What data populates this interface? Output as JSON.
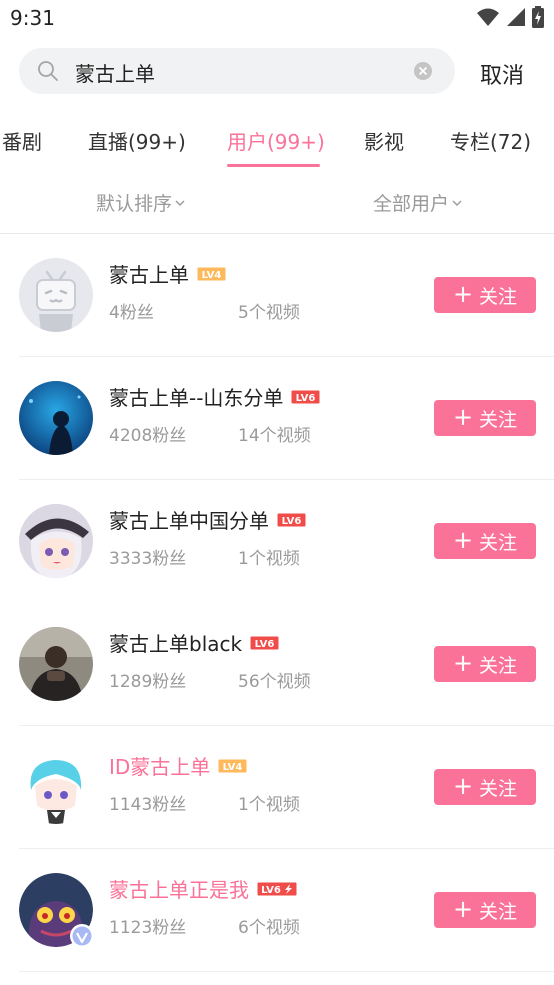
{
  "status": {
    "time": "9:31"
  },
  "search": {
    "query": "蒙古上单",
    "cancel_label": "取消"
  },
  "tabs": [
    {
      "label": "番剧"
    },
    {
      "label": "直播(99+)"
    },
    {
      "label": "用户(99+)"
    },
    {
      "label": "影视"
    },
    {
      "label": "专栏(72)"
    }
  ],
  "filters": {
    "sort_label": "默认排序",
    "type_label": "全部用户"
  },
  "users": [
    {
      "name": "蒙古上单",
      "level": "LV4",
      "fans": "4粉丝",
      "videos": "5个视频",
      "follow": "关注"
    },
    {
      "name": "蒙古上单--山东分单",
      "level": "LV6",
      "fans": "4208粉丝",
      "videos": "14个视频",
      "follow": "关注"
    },
    {
      "name": "蒙古上单中国分单",
      "level": "LV6",
      "fans": "3333粉丝",
      "videos": "1个视频",
      "follow": "关注"
    },
    {
      "name": "蒙古上单black",
      "level": "LV6",
      "fans": "1289粉丝",
      "videos": "56个视频",
      "follow": "关注"
    },
    {
      "name": "ID蒙古上单",
      "level": "LV4",
      "fans": "1143粉丝",
      "videos": "1个视频",
      "follow": "关注"
    },
    {
      "name": "蒙古上单正是我",
      "level": "LV6",
      "fans": "1123粉丝",
      "videos": "6个视频",
      "follow": "关注"
    }
  ],
  "colors": {
    "accent": "#fb7299",
    "lv4": "#fdb95b",
    "lv6": "#f04c49"
  }
}
